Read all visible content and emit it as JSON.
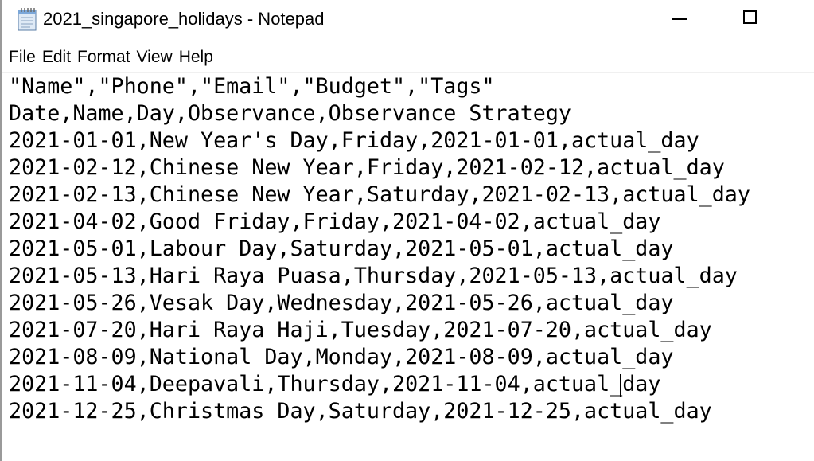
{
  "window": {
    "title": "2021_singapore_holidays - Notepad",
    "icon": "notepad-icon"
  },
  "menu": {
    "items": [
      "File",
      "Edit",
      "Format",
      "View",
      "Help"
    ]
  },
  "editor": {
    "lines": [
      "\"Name\",\"Phone\",\"Email\",\"Budget\",\"Tags\"",
      "Date,Name,Day,Observance,Observance Strategy",
      "2021-01-01,New Year's Day,Friday,2021-01-01,actual_day",
      "2021-02-12,Chinese New Year,Friday,2021-02-12,actual_day",
      "2021-02-13,Chinese New Year,Saturday,2021-02-13,actual_day",
      "2021-04-02,Good Friday,Friday,2021-04-02,actual_day",
      "2021-05-01,Labour Day,Saturday,2021-05-01,actual_day",
      "2021-05-13,Hari Raya Puasa,Thursday,2021-05-13,actual_day",
      "2021-05-26,Vesak Day,Wednesday,2021-05-26,actual_day",
      "2021-07-20,Hari Raya Haji,Tuesday,2021-07-20,actual_day",
      "2021-08-09,National Day,Monday,2021-08-09,actual_day",
      "2021-11-04,Deepavali,Thursday,2021-11-04,actual_day",
      "2021-12-25,Christmas Day,Saturday,2021-12-25,actual_day"
    ]
  }
}
